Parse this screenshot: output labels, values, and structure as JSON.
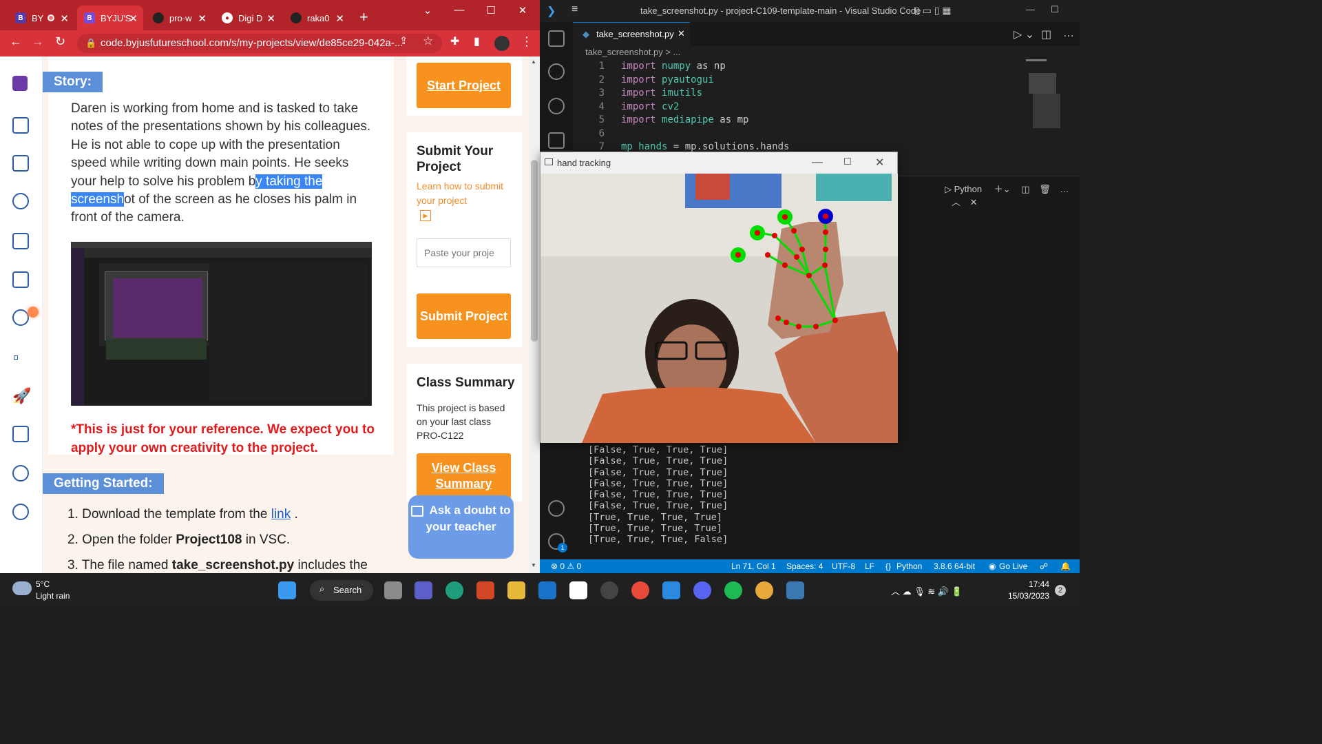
{
  "browser": {
    "tabs": [
      {
        "label": "BY",
        "color": "#5a3aa8"
      },
      {
        "label": "BYJU'S",
        "color": "#5a3aa8"
      },
      {
        "label": "pro-w",
        "color": "#222222"
      },
      {
        "label": "Digi D",
        "color": "#ffffff"
      },
      {
        "label": "raka0",
        "color": "#222222"
      }
    ],
    "url": "code.byjusfutureschool.com/s/my-projects/view/de85ce29-042a-..."
  },
  "page": {
    "story_label": "Story:",
    "story_text_before": "Daren is working from home and is tasked to take notes of the presentations shown by his colleagues. He is not able to cope up with the presentation speed while writing down main points. He seeks your help to solve his problem b",
    "story_text_highlight": "y taking the screensh",
    "story_text_after": "ot of the screen as he closes his palm in front of the camera.",
    "reference_note": "*This is just for your reference. We expect you to apply your own creativity to the project.",
    "getting_started_label": "Getting Started:",
    "step1_prefix": "1. Download the template from the ",
    "step1_link": "link",
    "step1_suffix": " .",
    "step2_prefix": "2. Open the folder ",
    "step2_bold": "Project108",
    "step2_suffix": " in VSC.",
    "step3_prefix": "3. The file named ",
    "step3_bold": "take_screenshot.py",
    "step3_suffix": " includes the"
  },
  "sidebar_right": {
    "start_project": "Start Project",
    "submit_title": "Submit Your Project",
    "learn_link": "Learn how to submit your project",
    "paste_placeholder": "Paste your proje",
    "submit_project": "Submit Project",
    "class_summary_title": "Class Summary",
    "class_summary_text": "This project is based on your last class PRO-C122",
    "view_class_summary": "View Class Summary",
    "ask_doubt": "Ask a doubt to your teacher"
  },
  "vscode": {
    "title": "take_screenshot.py - project-C109-template-main - Visual Studio Code",
    "tab": "take_screenshot.py",
    "breadcrumb": "take_screenshot.py > ...",
    "code_lines": [
      {
        "n": "1",
        "kw": "import",
        "mod": "numpy",
        "rest": " as np"
      },
      {
        "n": "2",
        "kw": "import",
        "mod": "pyautogui",
        "rest": ""
      },
      {
        "n": "3",
        "kw": "import",
        "mod": "imutils",
        "rest": ""
      },
      {
        "n": "4",
        "kw": "import",
        "mod": "cv2",
        "rest": ""
      },
      {
        "n": "5",
        "kw": "import",
        "mod": "mediapipe",
        "rest": " as mp"
      },
      {
        "n": "6",
        "kw": "",
        "mod": "",
        "rest": ""
      },
      {
        "n": "7",
        "kw": "",
        "mod": "mp_hands",
        "rest": " = mp.solutions.hands"
      }
    ],
    "panel_label": "Python",
    "terminal": [
      "[False, True, True, True]",
      "[False, True, True, True]",
      "[False, True, True, True]",
      "[False, True, True, True]",
      "[False, True, True, True]",
      "[False, True, True, True]",
      "[True, True, True, True]",
      "[True, True, True, True]",
      "[True, True, True, False]"
    ],
    "status": {
      "errors": "⊗ 0 ⚠ 0",
      "position": "Ln 71, Col 1",
      "spaces": "Spaces: 4",
      "encoding": "UTF-8",
      "eol": "LF",
      "language": "Python",
      "interpreter": "3.8.6 64-bit",
      "golive": "Go Live"
    }
  },
  "hand_window": {
    "title": "hand tracking"
  },
  "taskbar": {
    "weather_temp": "5°C",
    "weather_desc": "Light rain",
    "search": "Search",
    "time": "17:44",
    "date": "15/03/2023",
    "notif": "2"
  }
}
